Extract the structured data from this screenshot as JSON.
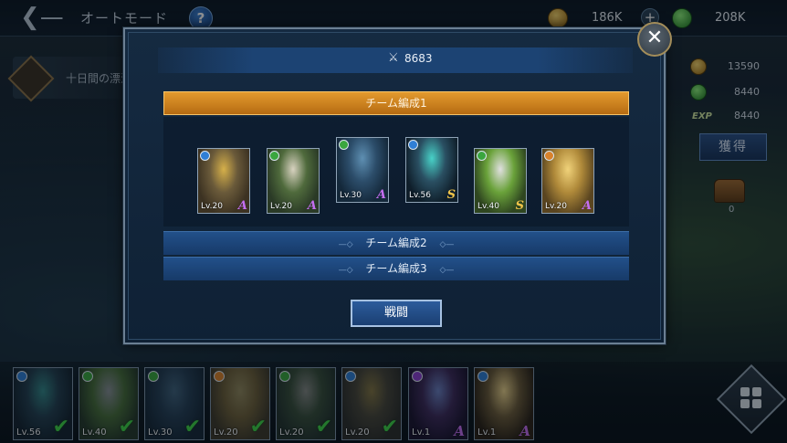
{
  "topbar": {
    "mode_title": "オートモード",
    "help_label": "?",
    "gold": "186K",
    "gems": "208K",
    "plus_label": "+"
  },
  "quest": {
    "text": "十日間の漂流"
  },
  "side_rewards": {
    "gold": "13590",
    "green": "8440",
    "exp_label": "EXP",
    "exp": "8440",
    "obtain_label": "獲得",
    "chest_count": "0"
  },
  "dialog": {
    "power": "8683",
    "close_label": "✕",
    "team1_label": "チーム編成1",
    "team2_label": "チーム編成2",
    "team3_label": "チーム編成3",
    "battle_label": "戦闘",
    "team1_heroes": [
      {
        "level": "Lv.20",
        "rank": "A",
        "element": "water",
        "palette": [
          "#d6b04a",
          "#6a5a3a",
          "#3c3222"
        ]
      },
      {
        "level": "Lv.20",
        "rank": "A",
        "element": "nature",
        "palette": [
          "#d8d2c0",
          "#4f6a3c",
          "#2a3a26"
        ]
      },
      {
        "level": "Lv.30",
        "rank": "A",
        "element": "nature",
        "palette": [
          "#5e8fb2",
          "#2c4d6a",
          "#14283a"
        ]
      },
      {
        "level": "Lv.56",
        "rank": "S",
        "element": "water",
        "palette": [
          "#48d2c8",
          "#2a4f62",
          "#0f1e2a"
        ]
      },
      {
        "level": "Lv.40",
        "rank": "S",
        "element": "nature",
        "palette": [
          "#e0e0e0",
          "#6aa23a",
          "#2f4620"
        ]
      },
      {
        "level": "Lv.20",
        "rank": "A",
        "element": "fire",
        "palette": [
          "#f0d27a",
          "#b08a3a",
          "#5a4520"
        ]
      }
    ]
  },
  "roster": [
    {
      "level": "Lv.56",
      "element": "water",
      "selected": true,
      "rank": "",
      "palette": [
        "#48d2c8",
        "#2a4f62",
        "#0f1e2a"
      ]
    },
    {
      "level": "Lv.40",
      "element": "nature",
      "selected": true,
      "rank": "",
      "palette": [
        "#e0e0e0",
        "#6aa23a",
        "#2f4620"
      ]
    },
    {
      "level": "Lv.30",
      "element": "nature",
      "selected": true,
      "rank": "",
      "palette": [
        "#5e8fb2",
        "#2c4d6a",
        "#14283a"
      ]
    },
    {
      "level": "Lv.20",
      "element": "fire",
      "selected": true,
      "rank": "",
      "palette": [
        "#f0d27a",
        "#b08a3a",
        "#5a4520"
      ]
    },
    {
      "level": "Lv.20",
      "element": "nature",
      "selected": true,
      "rank": "",
      "palette": [
        "#d8d2c0",
        "#4f6a3c",
        "#2a3a26"
      ]
    },
    {
      "level": "Lv.20",
      "element": "water",
      "selected": true,
      "rank": "",
      "palette": [
        "#d6b04a",
        "#6a5a3a",
        "#3c3222"
      ]
    },
    {
      "level": "Lv.1",
      "element": "dark",
      "selected": false,
      "rank": "A",
      "palette": [
        "#6a7fc0",
        "#3c2a5a",
        "#1a1430"
      ]
    },
    {
      "level": "Lv.1",
      "element": "water",
      "selected": false,
      "rank": "A",
      "palette": [
        "#e8d08a",
        "#6a5a3a",
        "#2a2218"
      ]
    }
  ],
  "colors": {
    "accent_orange": "#e39a2e",
    "team_blue": "#22508a",
    "rank_a": "#c46ef0",
    "rank_s": "#f2c54a",
    "check_green": "#3fd248",
    "element_water": "#2f7fd6",
    "element_nature": "#3aa63e",
    "element_fire": "#d9822b",
    "element_dark": "#8a3fd0"
  }
}
